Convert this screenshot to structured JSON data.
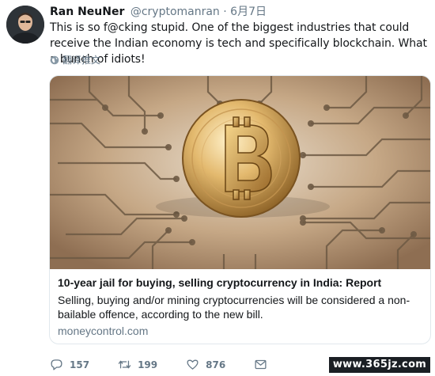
{
  "tweet": {
    "author": {
      "display_name": "Ran NeuNer",
      "handle": "@cryptomanran",
      "separator": "·",
      "date": "6月7日"
    },
    "text": "This is so f@cking stupid. One of the biggest industries that could receive the Indian economy is tech and specifically blockchain. What a bunch of idiots!",
    "translate_label": "翻译推文",
    "card": {
      "image_icon": "bitcoin-circuit-image",
      "title": "10-year jail for buying, selling cryptocurrency in India: Report",
      "description": "Selling, buying and/or mining cryptocurrencies will be considered a non-bailable offence, according to the new bill.",
      "domain": "moneycontrol.com"
    },
    "actions": {
      "reply_count": "157",
      "retweet_count": "199",
      "like_count": "876",
      "reply_icon": "reply-icon",
      "retweet_icon": "retweet-icon",
      "like_icon": "heart-icon",
      "dm_icon": "message-icon"
    }
  },
  "watermark": "www.365jz.com",
  "colors": {
    "text": "#14171a",
    "secondary": "#657786",
    "border": "#e1e8ed"
  }
}
